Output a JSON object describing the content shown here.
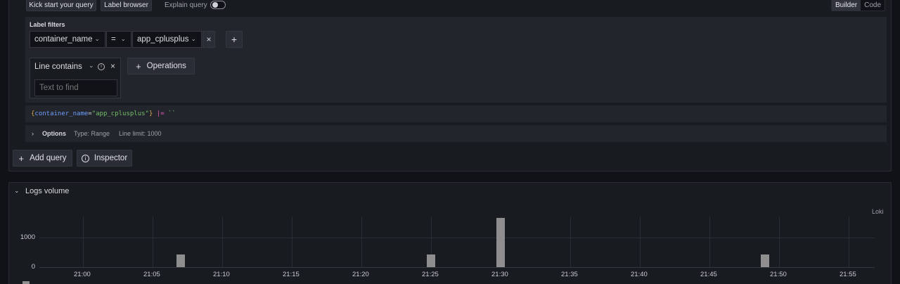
{
  "toolbar": {
    "kick_start": "Kick start your query",
    "label_browser": "Label browser",
    "explain_query": "Explain query",
    "mode_builder": "Builder",
    "mode_code": "Code"
  },
  "label_filters": {
    "title": "Label filters",
    "label": "container_name",
    "operator": "=",
    "value": "app_cplusplus"
  },
  "line_filter": {
    "type": "Line contains",
    "placeholder": "Text to find"
  },
  "operations_label": "Operations",
  "query_text": {
    "open": "{",
    "key": "container_name",
    "eq": "=",
    "val": "\"app_cplusplus\"",
    "close": "}",
    "pipe": " |= ",
    "str": "``"
  },
  "options": {
    "title": "Options",
    "type": "Type: Range",
    "limit": "Line limit: 1000"
  },
  "actions": {
    "add_query": "Add query",
    "inspector": "Inspector"
  },
  "logs_volume": {
    "title": "Logs volume",
    "source": "Loki"
  },
  "chart_data": {
    "type": "bar",
    "x_ticks": [
      "21:00",
      "21:05",
      "21:10",
      "21:15",
      "21:20",
      "21:25",
      "21:30",
      "21:35",
      "21:40",
      "21:45",
      "21:50",
      "21:55"
    ],
    "y_ticks": [
      "0",
      "1000"
    ],
    "ylim": [
      0,
      1700
    ],
    "grid": true,
    "series": [
      {
        "x": [
          "21:07",
          "21:25",
          "21:30",
          "21:49"
        ],
        "values": [
          430,
          430,
          1650,
          430
        ]
      }
    ],
    "bar_color": "#8e8e8e"
  }
}
